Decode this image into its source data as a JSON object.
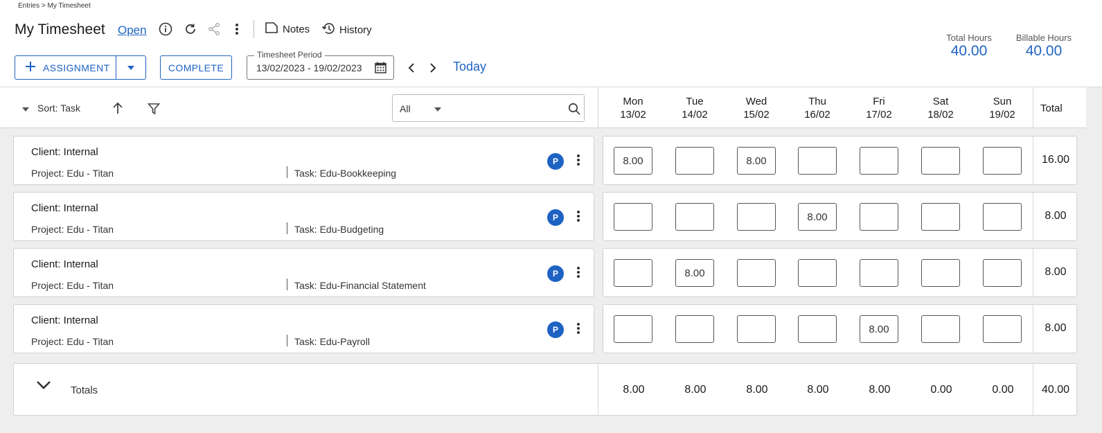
{
  "breadcrumb": "Entries > My Timesheet",
  "header": {
    "title": "My Timesheet",
    "status": "Open",
    "notes_label": "Notes",
    "history_label": "History"
  },
  "toolbar": {
    "assignment_label": "ASSIGNMENT",
    "complete_label": "COMPLETE",
    "period_legend": "Timesheet Period",
    "period_value": "13/02/2023 - 19/02/2023",
    "today_label": "Today"
  },
  "stats": {
    "total_hours_label": "Total Hours",
    "total_hours_value": "40.00",
    "billable_hours_label": "Billable Hours",
    "billable_hours_value": "40.00"
  },
  "grid": {
    "sort_label": "Sort: Task",
    "filter_value": "All",
    "total_header": "Total",
    "days": [
      {
        "day": "Mon",
        "date": "13/02"
      },
      {
        "day": "Tue",
        "date": "14/02"
      },
      {
        "day": "Wed",
        "date": "15/02"
      },
      {
        "day": "Thu",
        "date": "16/02"
      },
      {
        "day": "Fri",
        "date": "17/02"
      },
      {
        "day": "Sat",
        "date": "18/02"
      },
      {
        "day": "Sun",
        "date": "19/02"
      }
    ]
  },
  "rows": [
    {
      "client": "Client: Internal",
      "project": "Project: Edu - Titan",
      "task": "Task: Edu-Bookkeeping",
      "badge": "P",
      "hours": [
        "8.00",
        "",
        "8.00",
        "",
        "",
        "",
        ""
      ],
      "total": "16.00"
    },
    {
      "client": "Client: Internal",
      "project": "Project: Edu - Titan",
      "task": "Task: Edu-Budgeting",
      "badge": "P",
      "hours": [
        "",
        "",
        "",
        "8.00",
        "",
        "",
        ""
      ],
      "total": "8.00"
    },
    {
      "client": "Client: Internal",
      "project": "Project: Edu - Titan",
      "task": "Task: Edu-Financial Statement",
      "badge": "P",
      "hours": [
        "",
        "8.00",
        "",
        "",
        "",
        "",
        ""
      ],
      "total": "8.00"
    },
    {
      "client": "Client: Internal",
      "project": "Project: Edu - Titan",
      "task": "Task: Edu-Payroll",
      "badge": "P",
      "hours": [
        "",
        "",
        "",
        "",
        "8.00",
        "",
        ""
      ],
      "total": "8.00"
    }
  ],
  "totals": {
    "label": "Totals",
    "days": [
      "8.00",
      "8.00",
      "8.00",
      "8.00",
      "8.00",
      "0.00",
      "0.00"
    ],
    "grand_total": "40.00"
  },
  "colors": {
    "accent": "#1e63c4",
    "background": "#eeeeee"
  }
}
